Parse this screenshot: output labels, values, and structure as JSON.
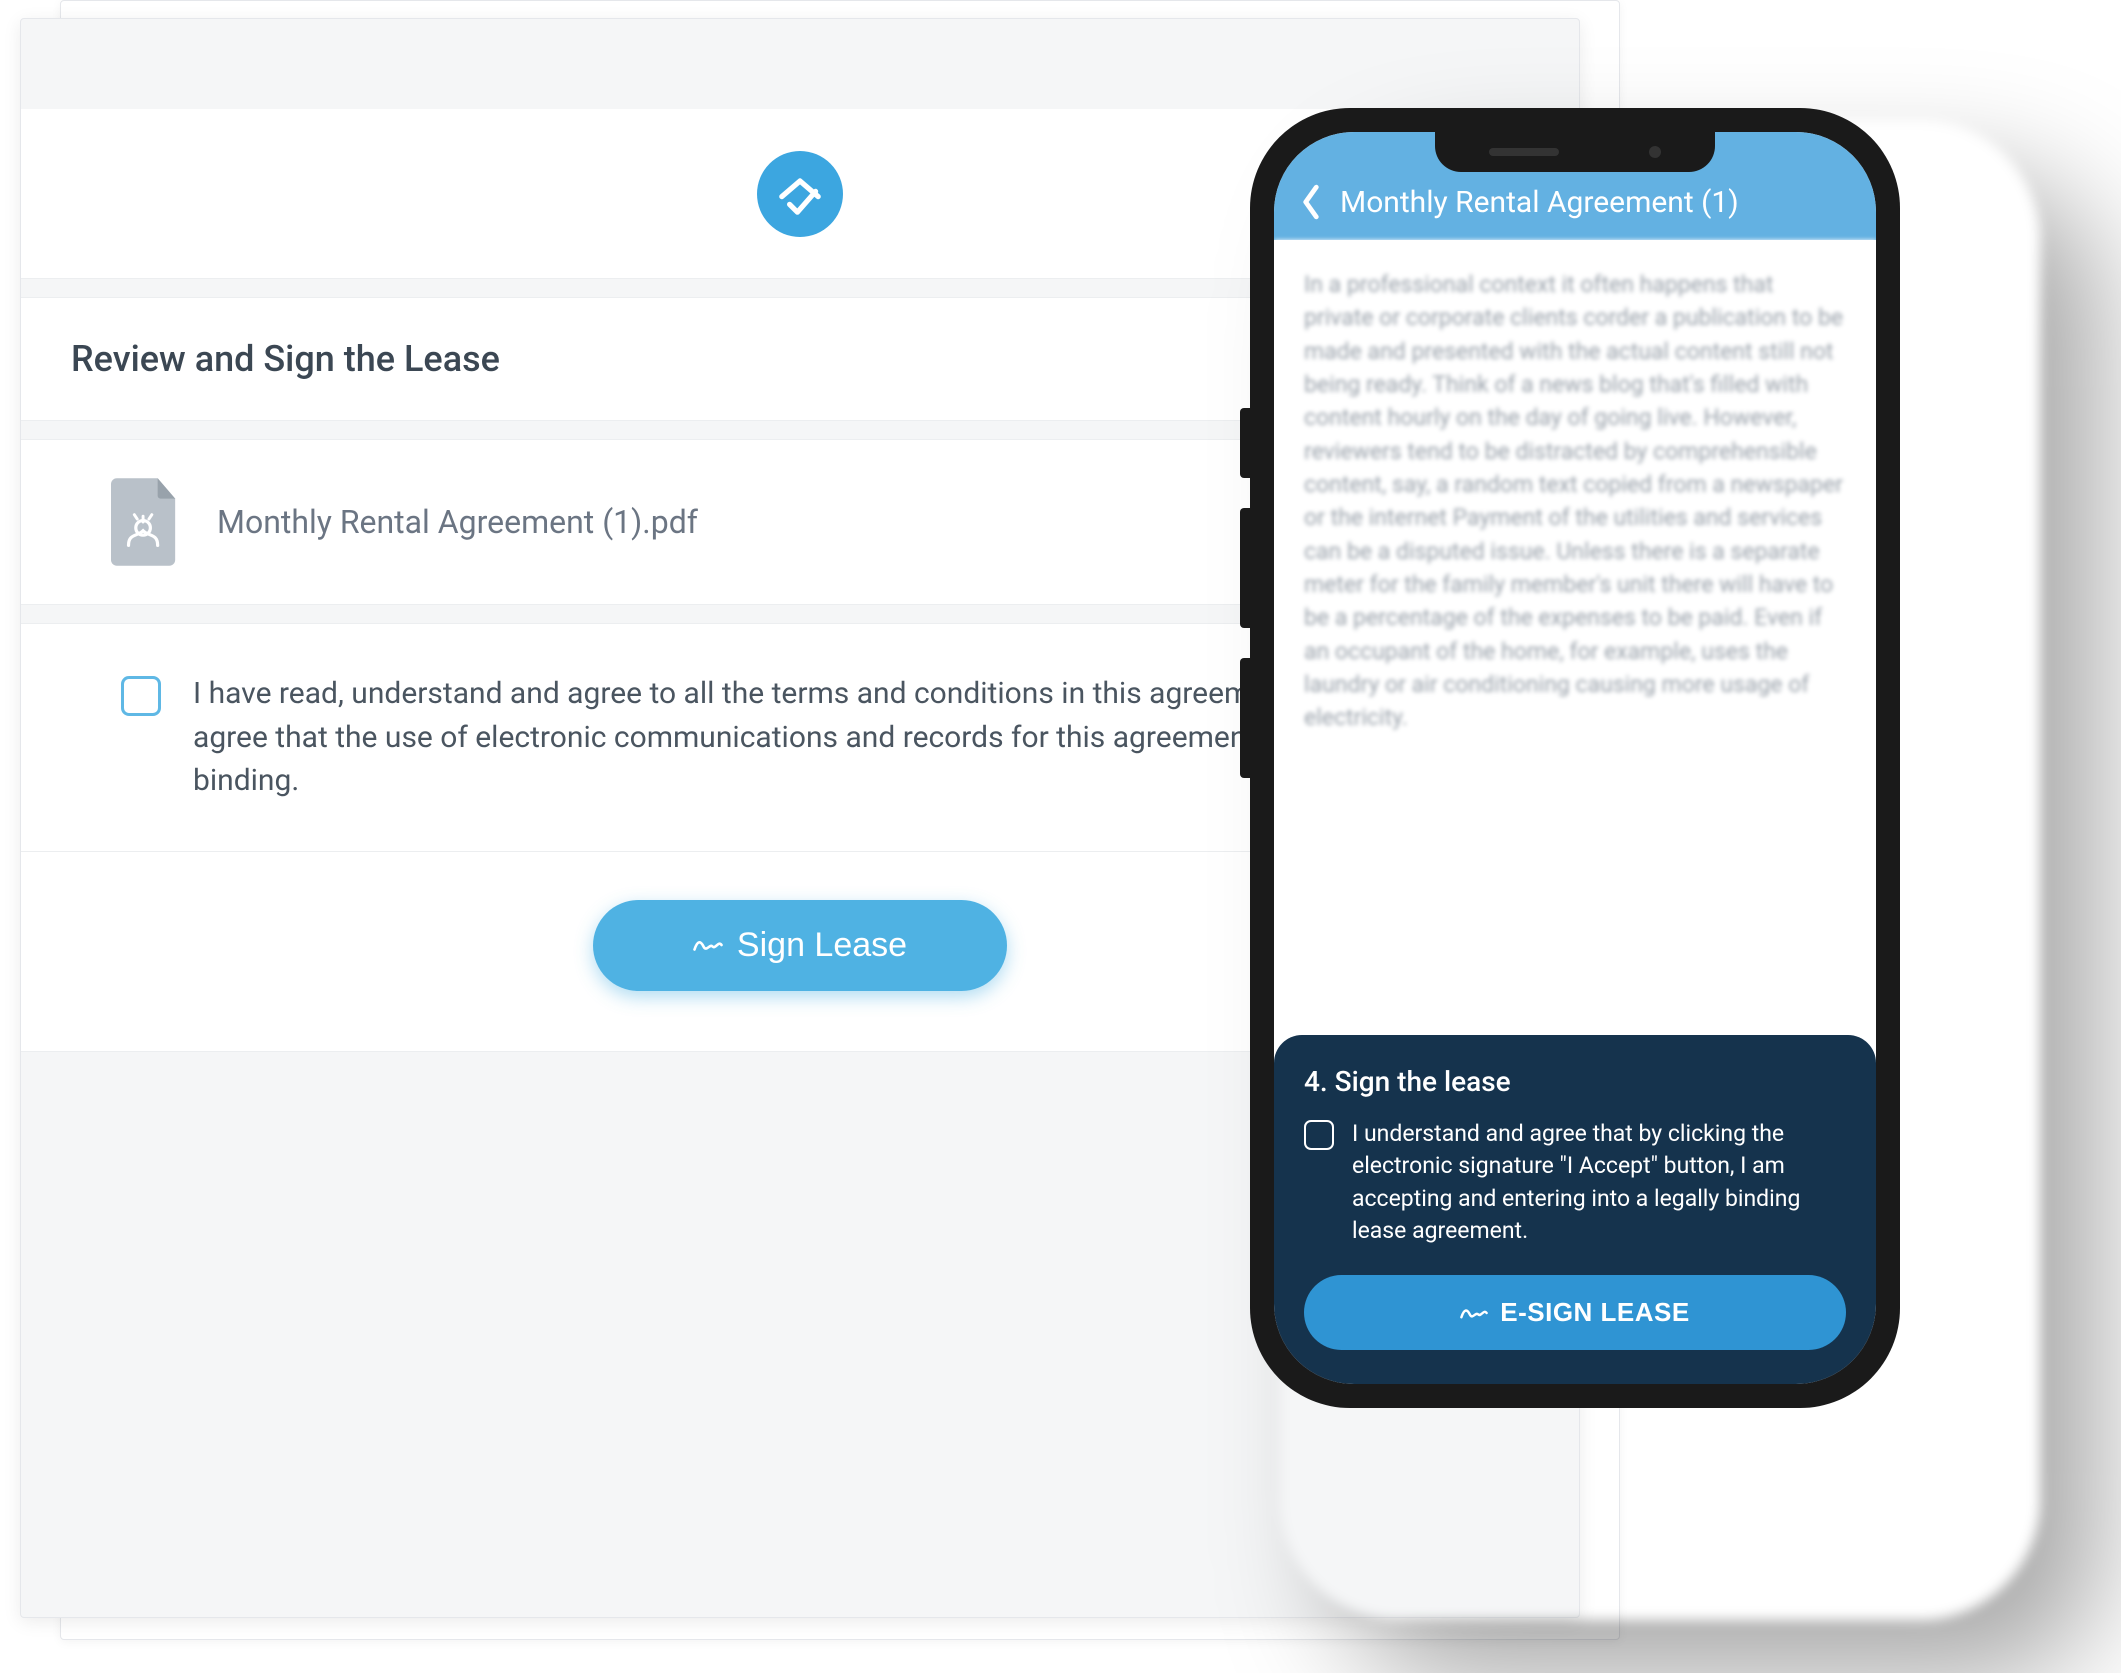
{
  "desktop": {
    "title": "Review and Sign the Lease",
    "file_name": "Monthly Rental Agreement (1).pdf",
    "agree_text": "I have read, understand and agree to all the terms and conditions in this agreement, and I hereby agree that the use of electronic communications and records for this agreement is legally binding.",
    "sign_label": "Sign Lease"
  },
  "phone": {
    "header_title": "Monthly Rental Agreement (1)",
    "doc_text": "In a professional context it often happens that private or corporate clients corder a publication to be made and presented with the actual content still not being ready. Think of a news blog that's filled with content hourly on the day of going live. However, reviewers tend to be distracted by comprehensible content, say, a random text copied from a newspaper or the internet Payment of the utilities and services can be a disputed issue. Unless there is a separate meter for the family member's unit there will have to be a percentage of the expenses to be paid. Even if an occupant of the home, for example, uses the laundry or air conditioning causing more usage of electricity.",
    "panel_title": "4. Sign the lease",
    "panel_agree": "I understand and agree that by clicking the electronic signature \"I Accept\" button, I am accepting and entering into a legally binding lease agreement.",
    "esign_label": "E-SIGN LEASE"
  },
  "colors": {
    "accent": "#4fb2e3",
    "panel_dark": "#15334d"
  }
}
